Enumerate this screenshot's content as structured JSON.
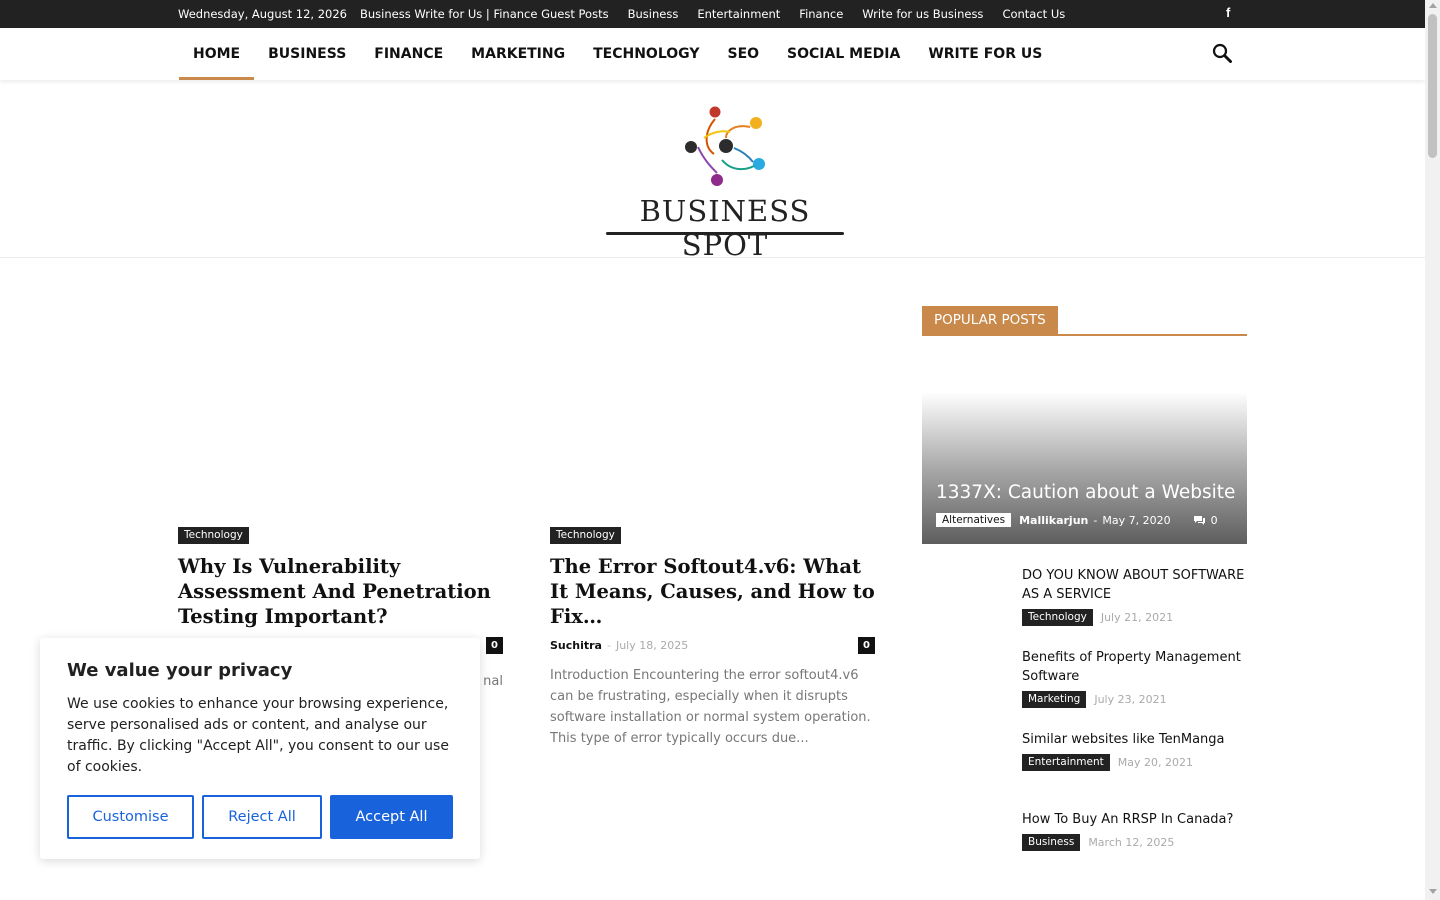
{
  "topbar": {
    "date": "Wednesday, August 12, 2026",
    "links": [
      "Business Write for Us | Finance Guest Posts",
      "Business",
      "Entertainment",
      "Finance",
      "Write for us Business",
      "Contact Us"
    ],
    "social_icon": "facebook-icon"
  },
  "nav": {
    "items": [
      "HOME",
      "BUSINESS",
      "FINANCE",
      "MARKETING",
      "TECHNOLOGY",
      "SEO",
      "SOCIAL MEDIA",
      "WRITE FOR US"
    ],
    "active": "HOME",
    "search_icon": "search-icon"
  },
  "logo": {
    "text": "BUSINESS SPOT"
  },
  "articles": [
    {
      "category": "Technology",
      "title": "Why Is Vulnerability Assessment And Penetration Testing Important?",
      "comments": "0",
      "excerpt_visible": "nal"
    },
    {
      "category": "Technology",
      "title": "The Error Softout4.v6: What It Means, Causes, and How to Fix…",
      "author": "Suchitra",
      "date": "July 18, 2025",
      "comments": "0",
      "excerpt": "Introduction Encountering the error softout4.v6 can be frustrating, especially when it disrupts software installation or normal system operation. This type of error typically occurs due..."
    }
  ],
  "sidebar": {
    "heading": "POPULAR POSTS",
    "featured": {
      "title": "1337X: Caution about a Website",
      "category": "Alternatives",
      "author": "Mallikarjun",
      "date": "May 7, 2020",
      "comments": "0"
    },
    "posts": [
      {
        "title": "DO YOU KNOW ABOUT SOFTWARE AS A SERVICE",
        "category": "Technology",
        "date": "July 21, 2021"
      },
      {
        "title": "Benefits of Property Management Software",
        "category": "Marketing",
        "date": "July 23, 2021"
      },
      {
        "title": "Similar websites like TenManga",
        "category": "Entertainment",
        "date": "May 20, 2021"
      },
      {
        "title": "How To Buy An RRSP In Canada?",
        "category": "Business",
        "date": "March 12, 2025"
      }
    ]
  },
  "cookie": {
    "title": "We value your privacy",
    "text": "We use cookies to enhance your browsing experience, serve personalised ads or content, and analyse our traffic. By clicking \"Accept All\", you consent to our use of cookies.",
    "customise": "Customise",
    "reject": "Reject All",
    "accept": "Accept All"
  },
  "colors": {
    "accent": "#c8894a",
    "dark": "#222222",
    "button_blue": "#1863dc"
  }
}
